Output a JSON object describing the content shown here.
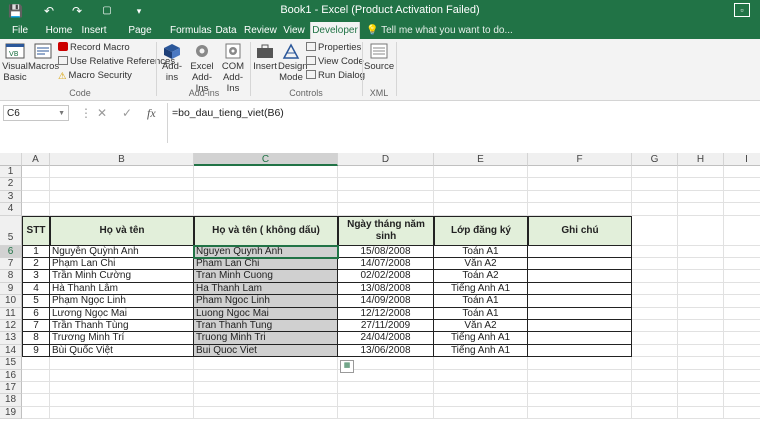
{
  "window": {
    "title": "Book1 - Excel (Product Activation Failed)"
  },
  "qat": {
    "save": "💾",
    "undo": "↶",
    "redo": "↷",
    "customize": "▾"
  },
  "tabs": [
    "File",
    "Home",
    "Insert",
    "Page Layout",
    "Formulas",
    "Data",
    "Review",
    "View",
    "Developer"
  ],
  "active_tab": "Developer",
  "tell_me": "Tell me what you want to do...",
  "ribbon": {
    "code": {
      "visual_basic": "Visual Basic",
      "macros": "Macros",
      "record_macro": "Record Macro",
      "use_relative": "Use Relative References",
      "macro_security": "Macro Security",
      "label": "Code"
    },
    "addins": {
      "add_ins": "Add-ins",
      "excel_addins": "Excel Add-Ins",
      "com_addins": "COM Add-Ins",
      "label": "Add-ins"
    },
    "controls": {
      "insert": "Insert",
      "design_mode": "Design Mode",
      "properties": "Properties",
      "view_code": "View Code",
      "run_dialog": "Run Dialog",
      "label": "Controls"
    },
    "xml": {
      "source": "Source",
      "label": "XML"
    }
  },
  "formula_bar": {
    "name_box": "C6",
    "cancel": "✕",
    "enter": "✓",
    "fx": "fx",
    "formula": "=bo_dau_tieng_viet(B6)"
  },
  "columns": [
    "A",
    "B",
    "C",
    "D",
    "E",
    "F",
    "G",
    "H",
    "I"
  ],
  "selected_column": "C",
  "rows": [
    "1",
    "2",
    "3",
    "4",
    "5",
    "6",
    "7",
    "8",
    "9",
    "10",
    "11",
    "12",
    "13",
    "14",
    "15",
    "16",
    "17",
    "18",
    "19"
  ],
  "selected_row": "6",
  "table": {
    "headers": [
      "STT",
      "Họ và tên",
      "Họ và tên ( không dấu)",
      "Ngày tháng năm sinh",
      "Lớp đăng ký",
      "Ghi chú"
    ],
    "rows": [
      [
        "1",
        "Nguyễn Quỳnh Anh",
        "Nguyen Quynh Anh",
        "15/08/2008",
        "Toán A1",
        ""
      ],
      [
        "2",
        "Phạm Lan Chi",
        "Pham Lan Chi",
        "14/07/2008",
        "Văn A2",
        ""
      ],
      [
        "3",
        "Trần Minh Cường",
        "Tran Minh Cuong",
        "02/02/2008",
        "Toán A2",
        ""
      ],
      [
        "4",
        "Hà Thanh Lâm",
        "Ha Thanh Lam",
        "13/08/2008",
        "Tiếng Anh A1",
        ""
      ],
      [
        "5",
        "Phạm Ngọc Linh",
        "Pham Ngoc Linh",
        "14/09/2008",
        "Toán A1",
        ""
      ],
      [
        "6",
        "Lương Ngọc Mai",
        "Luong Ngoc Mai",
        "12/12/2008",
        "Toán A1",
        ""
      ],
      [
        "7",
        "Trần Thanh Tùng",
        "Tran Thanh Tung",
        "27/11/2009",
        "Văn A2",
        ""
      ],
      [
        "8",
        "Trương Minh Trí",
        "Truong Minh Tri",
        "24/04/2008",
        "Tiếng Anh A1",
        ""
      ],
      [
        "9",
        "Bùi Quốc Việt",
        "Bui Quoc Viet",
        "13/06/2008",
        "Tiếng Anh A1",
        ""
      ]
    ]
  },
  "quick_analysis_icon": "quick-analysis-icon"
}
